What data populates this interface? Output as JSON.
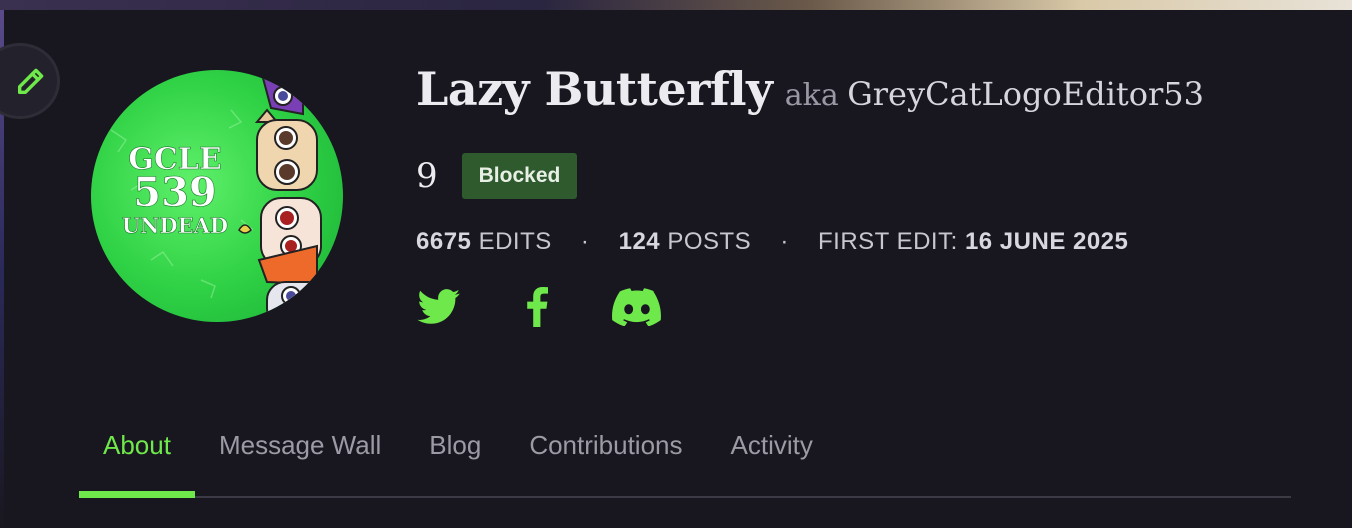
{
  "profile": {
    "display_name": "Lazy Butterfly",
    "aka": "aka",
    "username": "GreyCatLogoEditor53",
    "rank": "9",
    "status": "Blocked",
    "avatar": {
      "lines": [
        "GCLE",
        "539",
        "UNDEAD"
      ],
      "colors": {
        "background": "#36d84a",
        "text": "#ffffff"
      }
    }
  },
  "stats": {
    "edits_count": "6675",
    "edits_label": "EDITS",
    "posts_count": "124",
    "posts_label": "POSTS",
    "first_edit_label": "FIRST EDIT:",
    "first_edit_date": "16 JUNE 2025",
    "separator": "·"
  },
  "social": [
    {
      "name": "twitter-icon"
    },
    {
      "name": "facebook-icon"
    },
    {
      "name": "discord-icon"
    }
  ],
  "tabs": [
    {
      "label": "About",
      "active": true
    },
    {
      "label": "Message Wall",
      "active": false
    },
    {
      "label": "Blog",
      "active": false
    },
    {
      "label": "Contributions",
      "active": false
    },
    {
      "label": "Activity",
      "active": false
    }
  ],
  "colors": {
    "accent": "#6ee84a",
    "background": "#18161f",
    "badge": "#2f5a2e"
  }
}
